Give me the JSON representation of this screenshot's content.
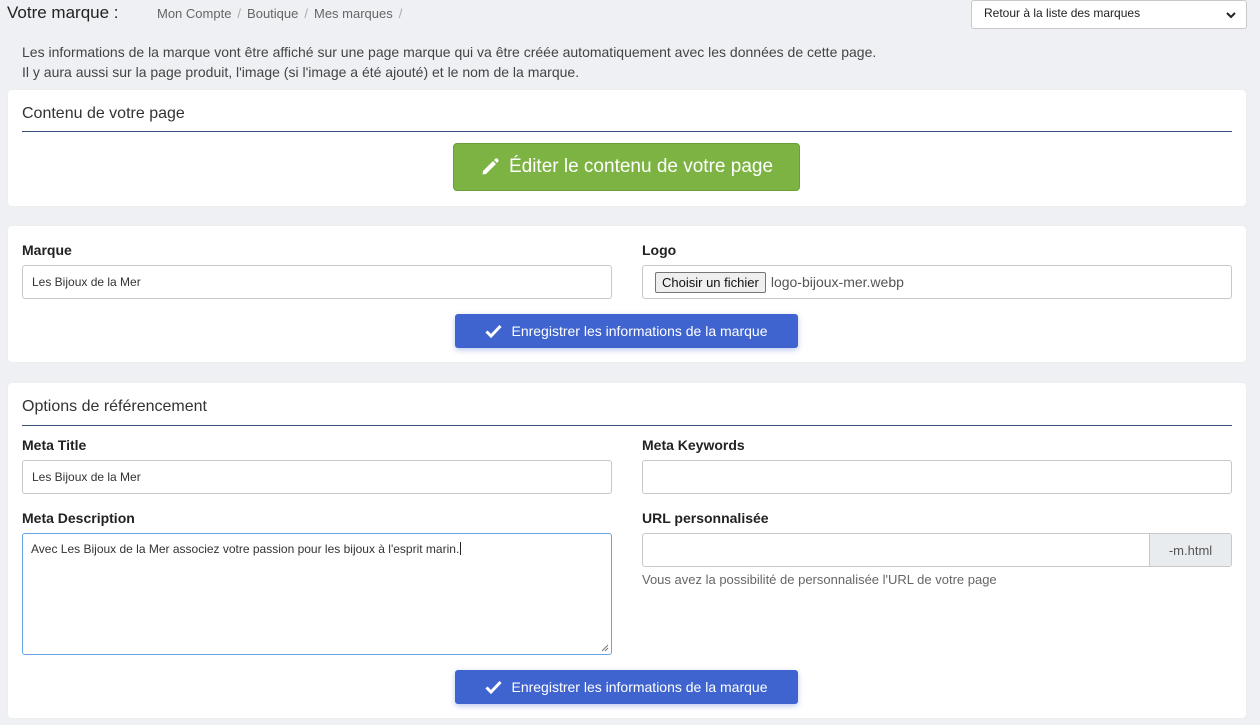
{
  "header": {
    "title": "Votre marque :",
    "breadcrumb": [
      "Mon Compte",
      "Boutique",
      "Mes marques"
    ],
    "back_select_value": "Retour à la liste des marques"
  },
  "intro": {
    "line1": "Les informations de la marque vont être affiché sur une page marque qui va être créée automatiquement avec les données de cette page.",
    "line2": "Il y aura aussi sur la page produit, l'image (si l'image a été ajouté) et le nom de la marque."
  },
  "content_section": {
    "title": "Contenu de votre page",
    "edit_button": "Éditer le contenu de votre page"
  },
  "brand_section": {
    "brand_label": "Marque",
    "brand_value": "Les Bijoux de la Mer",
    "logo_label": "Logo",
    "file_button": "Choisir un fichier",
    "file_name": "logo-bijoux-mer.webp",
    "save_button": "Enregistrer les informations de la marque"
  },
  "seo_section": {
    "title": "Options de référencement",
    "meta_title_label": "Meta Title",
    "meta_title_value": "Les Bijoux de la Mer",
    "meta_keywords_label": "Meta Keywords",
    "meta_keywords_value": "",
    "meta_description_label": "Meta Description",
    "meta_description_value": "Avec Les Bijoux de la Mer associez votre passion pour les bijoux à l'esprit marin.",
    "url_label": "URL personnalisée",
    "url_value": "",
    "url_suffix": "-m.html",
    "url_help": "Vous avez la possibilité de personnalisée l'URL de votre page",
    "save_button": "Enregistrer les informations de la marque"
  },
  "colors": {
    "edit_button": "#7cb342",
    "save_button": "#3f64cf",
    "section_rule": "#3a4f7a",
    "background": "#eef0f3"
  },
  "icons": {
    "edit_button_icon": "pencil-icon",
    "save_button_icon": "check-icon",
    "select_icon": "chevron-down-icon"
  }
}
